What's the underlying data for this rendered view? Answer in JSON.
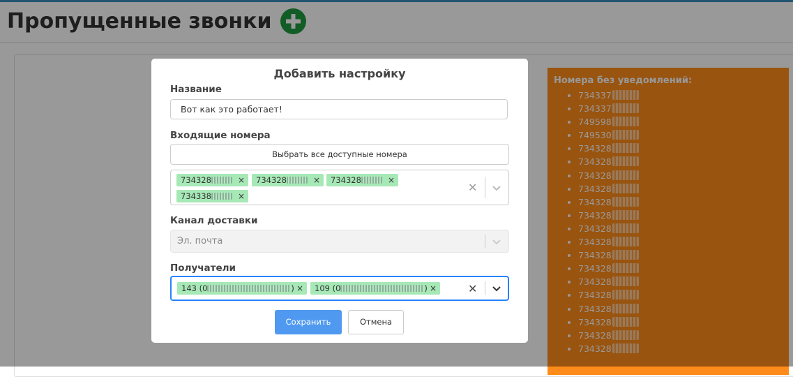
{
  "page": {
    "title": "Пропущенные звонки"
  },
  "sidebar_panel": {
    "title": "Номера без уведомлений:",
    "numbers": [
      "734337",
      "734337",
      "749598",
      "749530",
      "734328",
      "734328",
      "734328",
      "734328",
      "734328",
      "734328",
      "734328",
      "734328",
      "734328",
      "734328",
      "734328",
      "734328",
      "734328",
      "734328",
      "734328",
      "734328"
    ]
  },
  "modal": {
    "title": "Добавить настройку",
    "name_label": "Название",
    "name_value": "Вот как это работает!",
    "incoming_label": "Входящие номера",
    "select_all_label": "Выбрать все доступные номера",
    "incoming_tags": [
      "734328",
      "734328",
      "734328",
      "734338"
    ],
    "channel_label": "Канал доставки",
    "channel_placeholder": "Эл. почта",
    "recipients_label": "Получатели",
    "recipient_tags": [
      "143 (0",
      "109 (0"
    ],
    "recipient_tag_end": ")",
    "save_label": "Сохранить",
    "cancel_label": "Отмена",
    "remove_glyph": "×",
    "clear_glyph": "✕"
  },
  "colors": {
    "accent": "#3c8dbc",
    "orange": "#ff8c1a",
    "tag_green": "#a6e8b6",
    "save_blue": "#4f9af0",
    "focus_border": "#2684ff"
  },
  "icons": {
    "add": "plus-circle-icon",
    "chevron": "chevron-down-icon",
    "clear": "clear-icon",
    "remove": "close-icon"
  }
}
